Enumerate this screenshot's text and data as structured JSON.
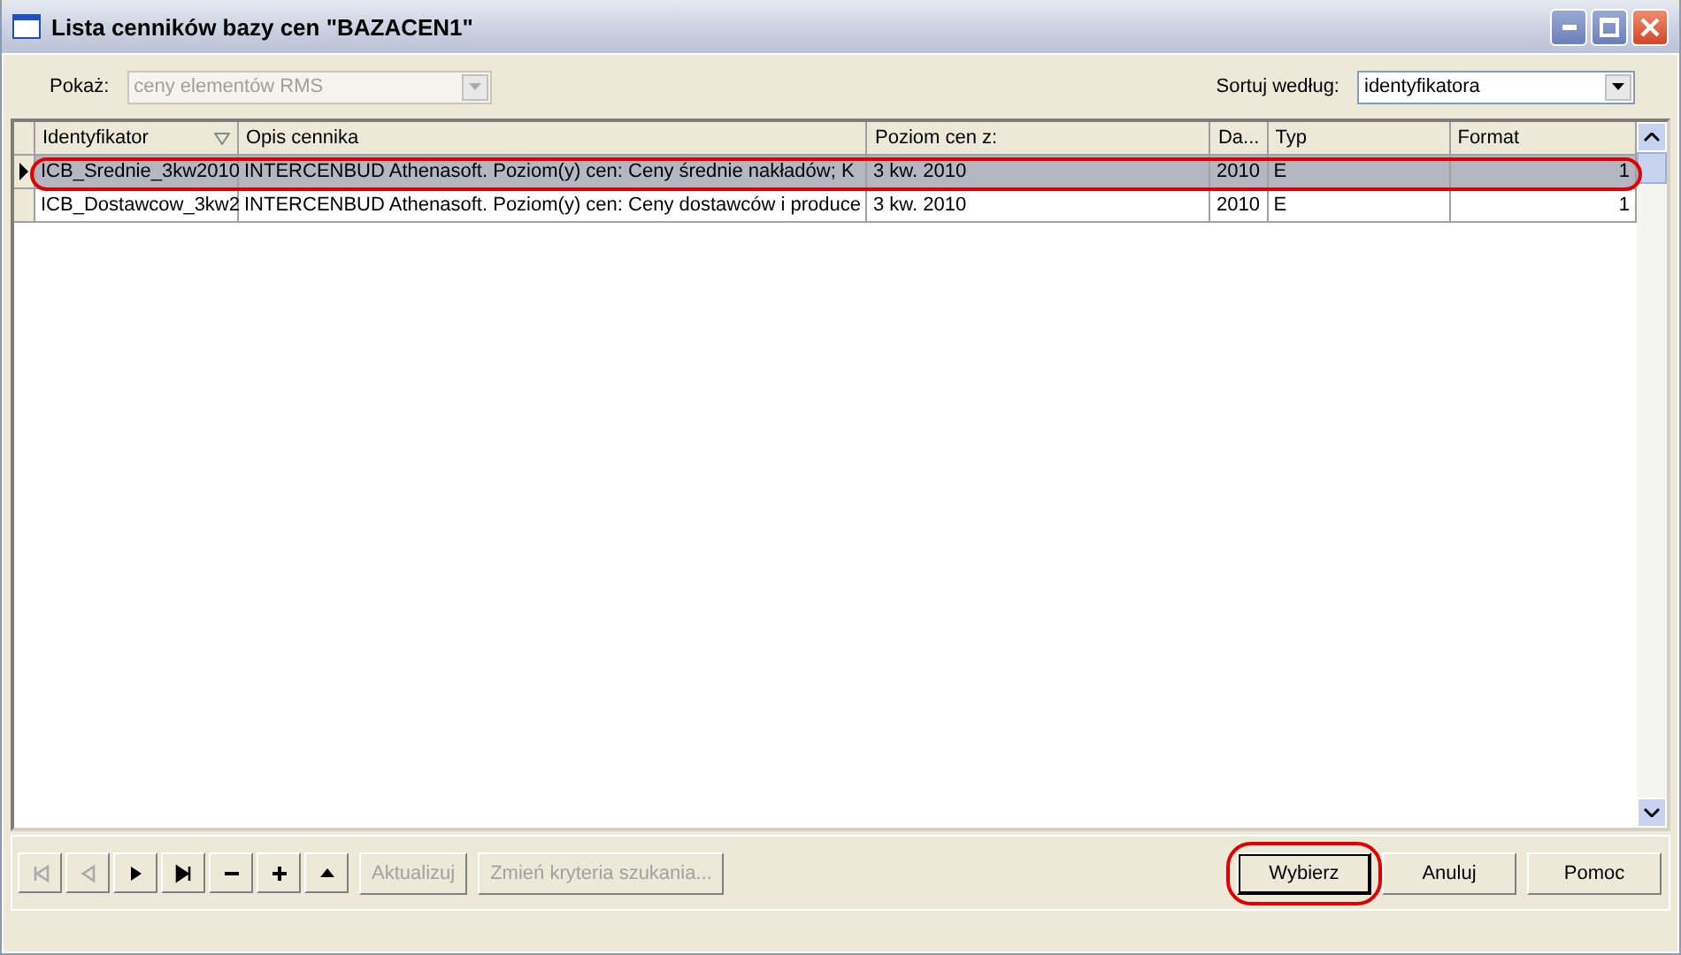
{
  "window": {
    "title": "Lista cenników bazy cen \"BAZACEN1\""
  },
  "filter": {
    "label": "Pokaż:",
    "value": "ceny elementów RMS",
    "disabled": true
  },
  "sort": {
    "label": "Sortuj według:",
    "value": "identyfikatora",
    "disabled": false
  },
  "table": {
    "columns": [
      {
        "label": "Identyfikator",
        "sorted": true
      },
      {
        "label": "Opis cennika",
        "sorted": false
      },
      {
        "label": "Poziom cen z:",
        "sorted": false
      },
      {
        "label": "Da...",
        "sorted": false
      },
      {
        "label": "Typ",
        "sorted": false
      },
      {
        "label": "Format",
        "sorted": false
      }
    ],
    "rows": [
      {
        "selected": true,
        "current": true,
        "highlighted": true,
        "cells": [
          "ICB_Srednie_3kw2010",
          "INTERCENBUD Athenasoft. Poziom(y) cen: Ceny średnie nakładów; K",
          "3 kw. 2010",
          "2010",
          "E",
          "1"
        ]
      },
      {
        "selected": false,
        "current": false,
        "highlighted": false,
        "cells": [
          "ICB_Dostawcow_3kw2",
          "INTERCENBUD Athenasoft. Poziom(y) cen: Ceny dostawców i produce",
          "3 kw. 2010",
          "2010",
          "E",
          "1"
        ]
      }
    ]
  },
  "nav_buttons": [
    {
      "kind": "first",
      "disabled": true
    },
    {
      "kind": "prev",
      "disabled": true
    },
    {
      "kind": "next",
      "disabled": false
    },
    {
      "kind": "last",
      "disabled": false
    },
    {
      "kind": "delete",
      "disabled": false
    },
    {
      "kind": "add",
      "disabled": false
    },
    {
      "kind": "up",
      "disabled": false
    }
  ],
  "action_buttons": [
    {
      "label": "Aktualizuj",
      "disabled": true
    },
    {
      "label": "Zmień kryteria szukania...",
      "disabled": true
    }
  ],
  "dialog_buttons": [
    {
      "label": "Wybierz",
      "default": true,
      "highlighted": true
    },
    {
      "label": "Anuluj",
      "default": false,
      "highlighted": false
    },
    {
      "label": "Pomoc",
      "default": false,
      "highlighted": false
    }
  ]
}
